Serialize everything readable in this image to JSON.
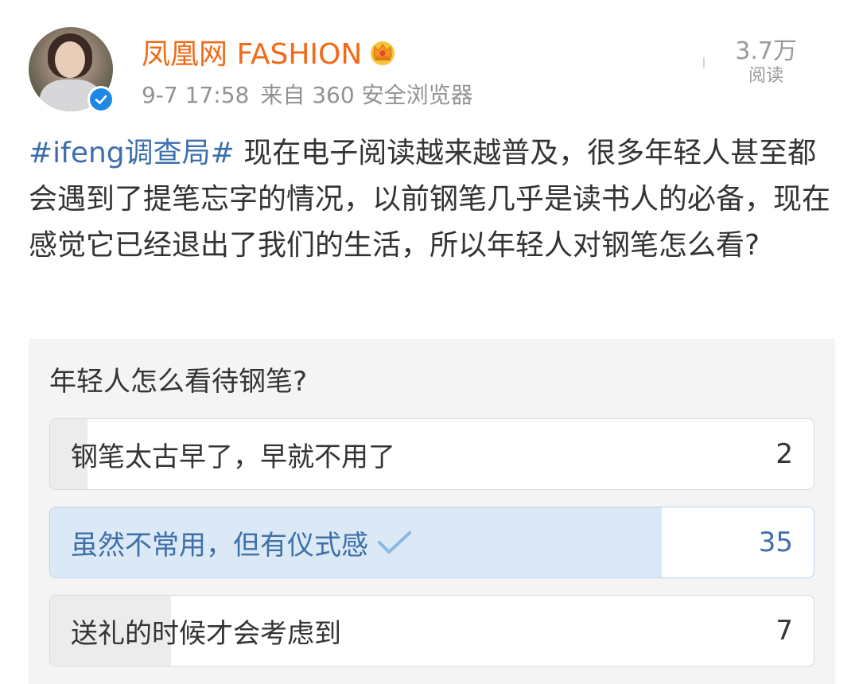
{
  "account": {
    "name": "凤凰网 FASHION",
    "date": "9-7 17:58",
    "source": "来自 360 安全浏览器",
    "icons": [
      "crown-icon",
      "verified-icon"
    ]
  },
  "stats": {
    "views_count": "3.7万",
    "views_label": "阅读"
  },
  "post": {
    "hashtag": "#ifeng调查局#",
    "text": " 现在电子阅读越来越普及，很多年轻人甚至都会遇到了提笔忘字的情况，以前钢笔几乎是读书人的必备，现在感觉它已经退出了我们的生活，所以年轻人对钢笔怎么看?"
  },
  "poll": {
    "question": "年轻人怎么看待钢笔?",
    "options": [
      {
        "label": "钢笔太古早了，早就不用了",
        "votes": "2",
        "selected": false
      },
      {
        "label": "虽然不常用，但有仪式感",
        "votes": "35",
        "selected": true
      },
      {
        "label": "送礼的时候才会考虑到",
        "votes": "7",
        "selected": false
      }
    ],
    "colors": {
      "accent": "#3f6fa8",
      "brand": "#f26a17",
      "selected_fill": "#dbe9f6",
      "fill": "#ececec"
    }
  }
}
